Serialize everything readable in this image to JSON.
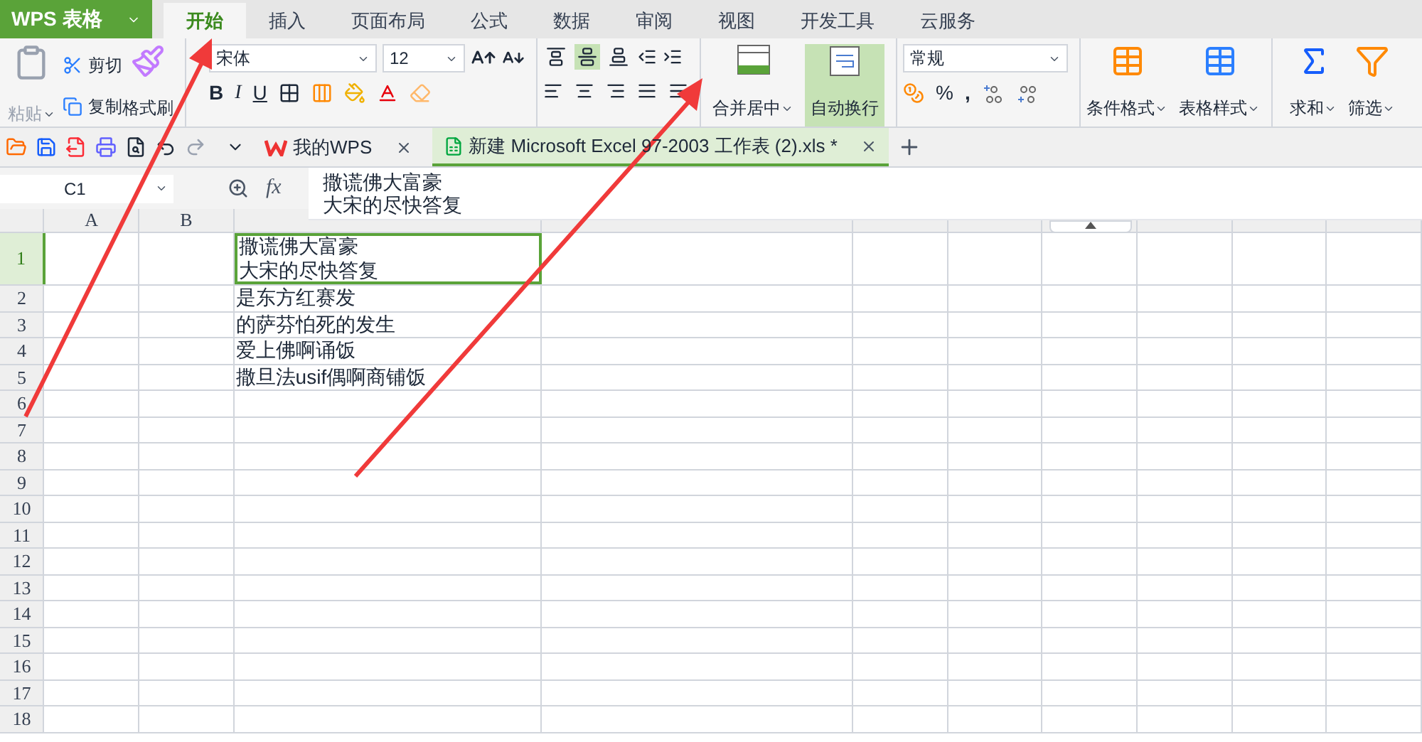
{
  "app": {
    "title": "WPS 表格"
  },
  "tabs": [
    {
      "label": "开始",
      "selected": true
    },
    {
      "label": "插入",
      "selected": false
    },
    {
      "label": "页面布局",
      "selected": false
    },
    {
      "label": "公式",
      "selected": false
    },
    {
      "label": "数据",
      "selected": false
    },
    {
      "label": "审阅",
      "selected": false
    },
    {
      "label": "视图",
      "selected": false
    },
    {
      "label": "开发工具",
      "selected": false
    },
    {
      "label": "云服务",
      "selected": false
    }
  ],
  "ribbon": {
    "paste": "粘贴",
    "cut": "剪切",
    "copy": "复制",
    "format_painter": "格式刷",
    "font_name": "宋体",
    "font_size": "12",
    "bold": "B",
    "italic": "I",
    "underline": "U",
    "align_top": [
      {
        "selected": false
      },
      {
        "selected": true
      },
      {
        "selected": false
      }
    ],
    "merge": "合并居中",
    "wrap": {
      "label": "自动换行",
      "on": true
    },
    "number_format": "常规",
    "percent": "%",
    "comma": ",",
    "conditional_format": "条件格式",
    "table_style": "表格样式",
    "sum": "求和",
    "filter": "筛选"
  },
  "doc_tabs": [
    {
      "label": "我的WPS",
      "selected": false
    },
    {
      "label": "新建 Microsoft Excel 97-2003 工作表 (2).xls *",
      "selected": true
    }
  ],
  "name_box": "C1",
  "fx": "fx",
  "formula": [
    "撒谎佛大富豪",
    "大宋的尽快答复"
  ],
  "columns": [
    "A",
    "B"
  ],
  "rows": [
    {
      "number": "1",
      "selected": true,
      "c": [
        "撒谎佛大富豪",
        "大宋的尽快答复"
      ]
    },
    {
      "number": "2",
      "selected": false,
      "c": [
        "是东方红赛发"
      ]
    },
    {
      "number": "3",
      "selected": false,
      "c": [
        "的萨芬怕死的发生"
      ]
    },
    {
      "number": "4",
      "selected": false,
      "c": [
        "爱上佛啊诵饭"
      ]
    },
    {
      "number": "5",
      "selected": false,
      "c": [
        "撒旦法usif偶啊商铺饭"
      ]
    },
    {
      "number": "6",
      "selected": false,
      "c": []
    },
    {
      "number": "7",
      "selected": false,
      "c": []
    },
    {
      "number": "8",
      "selected": false,
      "c": []
    },
    {
      "number": "9",
      "selected": false,
      "c": []
    },
    {
      "number": "10",
      "selected": false,
      "c": []
    },
    {
      "number": "11",
      "selected": false,
      "c": []
    },
    {
      "number": "12",
      "selected": false,
      "c": []
    },
    {
      "number": "13",
      "selected": false,
      "c": []
    },
    {
      "number": "14",
      "selected": false,
      "c": []
    },
    {
      "number": "15",
      "selected": false,
      "c": []
    },
    {
      "number": "16",
      "selected": false,
      "c": []
    },
    {
      "number": "17",
      "selected": false,
      "c": []
    },
    {
      "number": "18",
      "selected": false,
      "c": []
    }
  ]
}
